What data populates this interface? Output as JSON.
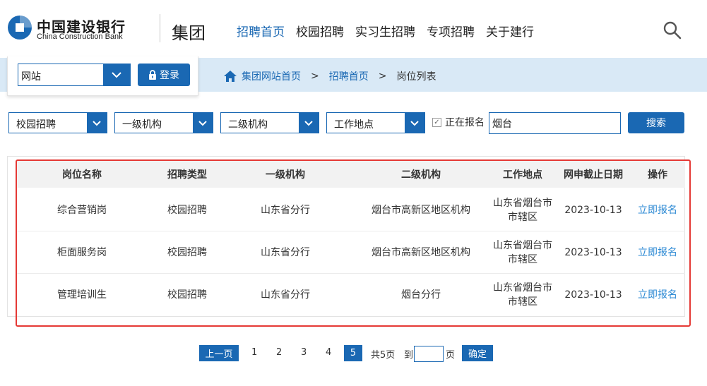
{
  "header": {
    "logo_cn": "中国建设银行",
    "logo_en": "China Construction Bank",
    "group_label": "集团",
    "nav": [
      {
        "label": "招聘首页",
        "active": true
      },
      {
        "label": "校园招聘",
        "active": false
      },
      {
        "label": "实习生招聘",
        "active": false
      },
      {
        "label": "专项招聘",
        "active": false
      },
      {
        "label": "关于建行",
        "active": false
      }
    ],
    "search_icon": "search-icon"
  },
  "site_box": {
    "select_value": "网站",
    "login_label": "登录",
    "login_icon": "lock-icon"
  },
  "breadcrumb": {
    "home_icon": "home-icon",
    "items": [
      "集团网站首页",
      "招聘首页",
      "岗位列表"
    ],
    "separator": ">"
  },
  "filters": {
    "recruit_type": "校园招聘",
    "org_level1": "一级机构",
    "org_level2": "二级机构",
    "work_location": "工作地点",
    "open_only_label": "正在报名",
    "open_only_checked": true,
    "keyword_value": "烟台",
    "search_label": "搜索"
  },
  "table": {
    "headers": [
      "岗位名称",
      "招聘类型",
      "一级机构",
      "二级机构",
      "工作地点",
      "网申截止日期",
      "操作"
    ],
    "rows": [
      {
        "name": "综合营销岗",
        "type": "校园招聘",
        "org1": "山东省分行",
        "org2": "烟台市高新区地区机构",
        "location": "山东省烟台市市辖区",
        "deadline": "2023-10-13",
        "action": "立即报名"
      },
      {
        "name": "柜面服务岗",
        "type": "校园招聘",
        "org1": "山东省分行",
        "org2": "烟台市高新区地区机构",
        "location": "山东省烟台市市辖区",
        "deadline": "2023-10-13",
        "action": "立即报名"
      },
      {
        "name": "管理培训生",
        "type": "校园招聘",
        "org1": "山东省分行",
        "org2": "烟台分行",
        "location": "山东省烟台市市辖区",
        "deadline": "2023-10-13",
        "action": "立即报名"
      }
    ]
  },
  "pagination": {
    "prev_label": "上一页",
    "pages": [
      "1",
      "2",
      "3",
      "4",
      "5"
    ],
    "current_page": "5",
    "total_text": "共5页",
    "goto_prefix": "到",
    "goto_suffix": "页",
    "confirm_label": "确定"
  },
  "colors": {
    "brand_blue": "#1a68b3",
    "crumb_bg": "#d9e9f6",
    "link_blue": "#2d8ad4",
    "highlight_red": "#e53935"
  }
}
